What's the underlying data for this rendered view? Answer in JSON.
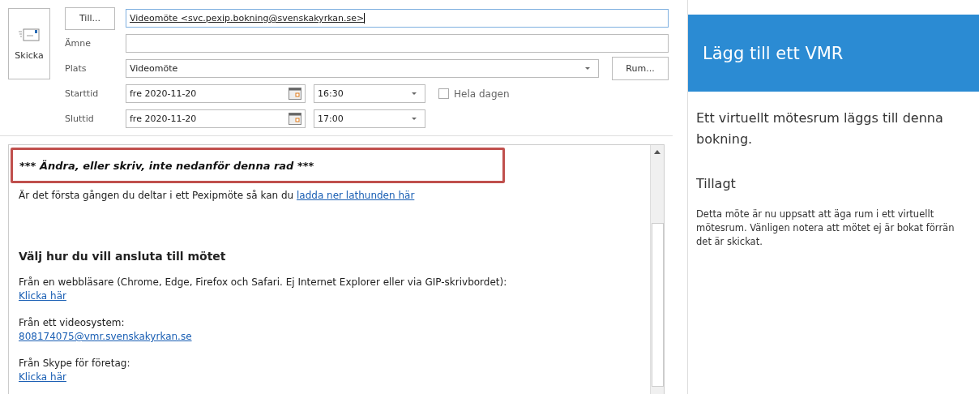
{
  "send_button": {
    "label": "Skicka"
  },
  "fields": [
    {
      "kind": "button",
      "label": "Till...",
      "value": "Videomöte <svc.pexip.bokning@svenskakyrkan.se>",
      "focused": true
    },
    {
      "kind": "label",
      "label": "Ämne"
    },
    {
      "kind": "dropdown",
      "label": "Plats",
      "value": "Videomöte",
      "side_button": "Rum..."
    }
  ],
  "times": [
    {
      "label": "Starttid",
      "date": "fre 2020-11-20",
      "time": "16:30"
    },
    {
      "label": "Sluttid",
      "date": "fre 2020-11-20",
      "time": "17:00"
    }
  ],
  "all_day": {
    "label": "Hela dagen",
    "checked": false
  },
  "body": {
    "notice": "*** Ändra, eller skriv, inte nedanför denna rad ***",
    "intro": {
      "text": "Är det första gången du deltar i ett Pexipmöte så kan du ",
      "link": "ladda ner lathunden här"
    },
    "heading": "Välj hur du vill ansluta till mötet",
    "options": [
      {
        "text": "Från en webbläsare (Chrome, Edge, Firefox och Safari. Ej Internet Explorer eller via GIP-skrivbordet):",
        "link": "Klicka här"
      },
      {
        "text": "Från ett videosystem:",
        "link": "808174075@vmr.svenskakyrkan.se"
      },
      {
        "text": "Från Skype för företag:",
        "link": "Klicka här"
      }
    ]
  },
  "panel": {
    "title": "Lägg till ett VMR",
    "lead": "Ett virtuellt mötesrum läggs till denna bokning.",
    "status": "Tillagt",
    "note": "Detta möte är nu uppsatt att äga rum i ett virtuellt mötesrum. Vänligen notera att mötet ej är bokat förrän det är skickat."
  }
}
